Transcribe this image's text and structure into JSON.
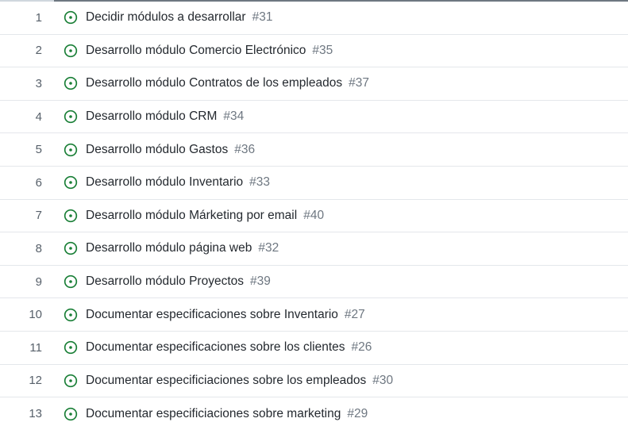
{
  "colors": {
    "open_icon": "#1a7f37",
    "text": "#24292f",
    "muted": "#6e7781",
    "divider": "#e4e7eb"
  },
  "rows": [
    {
      "index": "1",
      "icon": "issue-opened-icon",
      "title": "Decidir módulos a desarrollar",
      "number": "#31"
    },
    {
      "index": "2",
      "icon": "issue-opened-icon",
      "title": "Desarrollo módulo Comercio Electrónico",
      "number": "#35"
    },
    {
      "index": "3",
      "icon": "issue-opened-icon",
      "title": "Desarrollo módulo Contratos de los empleados",
      "number": "#37"
    },
    {
      "index": "4",
      "icon": "issue-opened-icon",
      "title": "Desarrollo módulo CRM",
      "number": "#34"
    },
    {
      "index": "5",
      "icon": "issue-opened-icon",
      "title": "Desarrollo módulo Gastos",
      "number": "#36"
    },
    {
      "index": "6",
      "icon": "issue-opened-icon",
      "title": "Desarrollo módulo Inventario",
      "number": "#33"
    },
    {
      "index": "7",
      "icon": "issue-opened-icon",
      "title": "Desarrollo módulo Márketing por email",
      "number": "#40"
    },
    {
      "index": "8",
      "icon": "issue-opened-icon",
      "title": "Desarrollo módulo página web",
      "number": "#32"
    },
    {
      "index": "9",
      "icon": "issue-opened-icon",
      "title": "Desarrollo módulo Proyectos",
      "number": "#39"
    },
    {
      "index": "10",
      "icon": "issue-opened-icon",
      "title": "Documentar especificaciones sobre Inventario",
      "number": "#27"
    },
    {
      "index": "11",
      "icon": "issue-opened-icon",
      "title": "Documentar especificaciones sobre los clientes",
      "number": "#26"
    },
    {
      "index": "12",
      "icon": "issue-opened-icon",
      "title": "Documentar especificiaciones sobre los empleados",
      "number": "#30"
    },
    {
      "index": "13",
      "icon": "issue-opened-icon",
      "title": "Documentar especificiaciones sobre marketing",
      "number": "#29"
    }
  ]
}
